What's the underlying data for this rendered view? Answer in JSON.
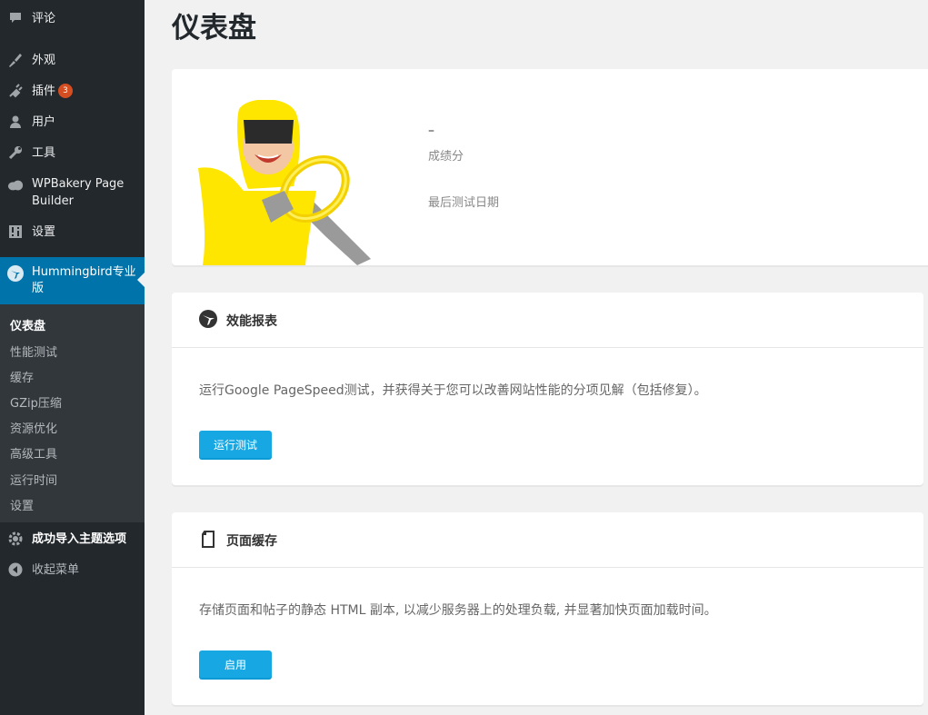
{
  "sidebar": {
    "items": [
      {
        "label": "评论",
        "icon": "comment-icon"
      },
      {
        "label": "外观",
        "icon": "brush-icon"
      },
      {
        "label": "插件",
        "icon": "plugin-icon",
        "badge": "3"
      },
      {
        "label": "用户",
        "icon": "user-icon"
      },
      {
        "label": "工具",
        "icon": "wrench-icon"
      },
      {
        "label": "WPBakery Page",
        "label2": "Builder",
        "icon": "cloud-icon"
      },
      {
        "label": "设置",
        "icon": "settings-sliders-icon"
      }
    ],
    "active": {
      "label": "Hummingbird专业",
      "label2": "版",
      "icon": "hummingbird-icon"
    },
    "submenu": [
      "仪表盘",
      "性能测试",
      "缓存",
      "GZip压缩",
      "资源优化",
      "高级工具",
      "运行时间",
      "设置"
    ],
    "after": [
      {
        "label": "成功导入主题选项",
        "icon": "gear-icon"
      },
      {
        "label": "收起菜单",
        "icon": "collapse-icon"
      }
    ]
  },
  "page": {
    "title": "仪表盘"
  },
  "summary": {
    "score": "–",
    "score_label": "成绩分",
    "last_test_label": "最后测试日期"
  },
  "performance": {
    "title": "效能报表",
    "description": "运行Google PageSpeed测试，并获得关于您可以改善网站性能的分项见解（包括修复）。",
    "button": "运行测试"
  },
  "page_cache": {
    "title": "页面缓存",
    "description": "存储页面和帖子的静态 HTML 副本, 以减少服务器上的处理负载, 并显著加快页面加载时间。",
    "button": "启用"
  },
  "colors": {
    "sidebar": "#23282d",
    "active": "#0073aa",
    "button": "#17a8e3",
    "badge": "#d54e21"
  }
}
